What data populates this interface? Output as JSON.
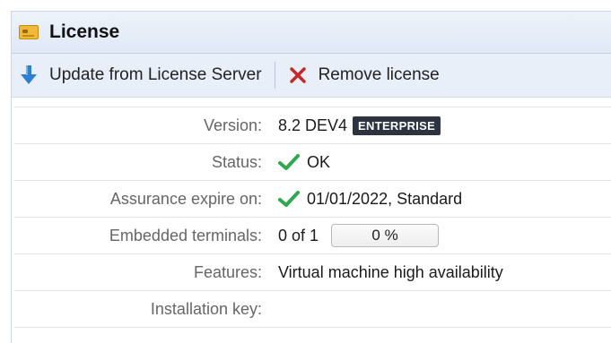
{
  "window": {
    "title": "License",
    "icon": "license-card-icon"
  },
  "toolbar": {
    "update_label": "Update from License Server",
    "update_icon": "arrow-down-icon",
    "remove_label": "Remove license",
    "remove_icon": "close-icon"
  },
  "properties": {
    "version": {
      "label": "Version:",
      "value": "8.2 DEV4",
      "badge": "ENTERPRISE"
    },
    "status": {
      "label": "Status:",
      "value": "OK",
      "icon": "check-icon"
    },
    "assurance": {
      "label": "Assurance expire on:",
      "value": "01/01/2022, Standard",
      "icon": "check-icon"
    },
    "embedded": {
      "label": "Embedded terminals:",
      "value": "0 of 1",
      "progress_text": "0 %",
      "progress_fraction": 0
    },
    "features": {
      "label": "Features:",
      "value": "Virtual machine high availability"
    },
    "installation_key": {
      "label": "Installation key:",
      "value": ""
    }
  },
  "colors": {
    "check": "#2fa84f",
    "remove": "#c62828",
    "arrow": "#2f7fd1",
    "badge_bg": "#2d3440"
  }
}
